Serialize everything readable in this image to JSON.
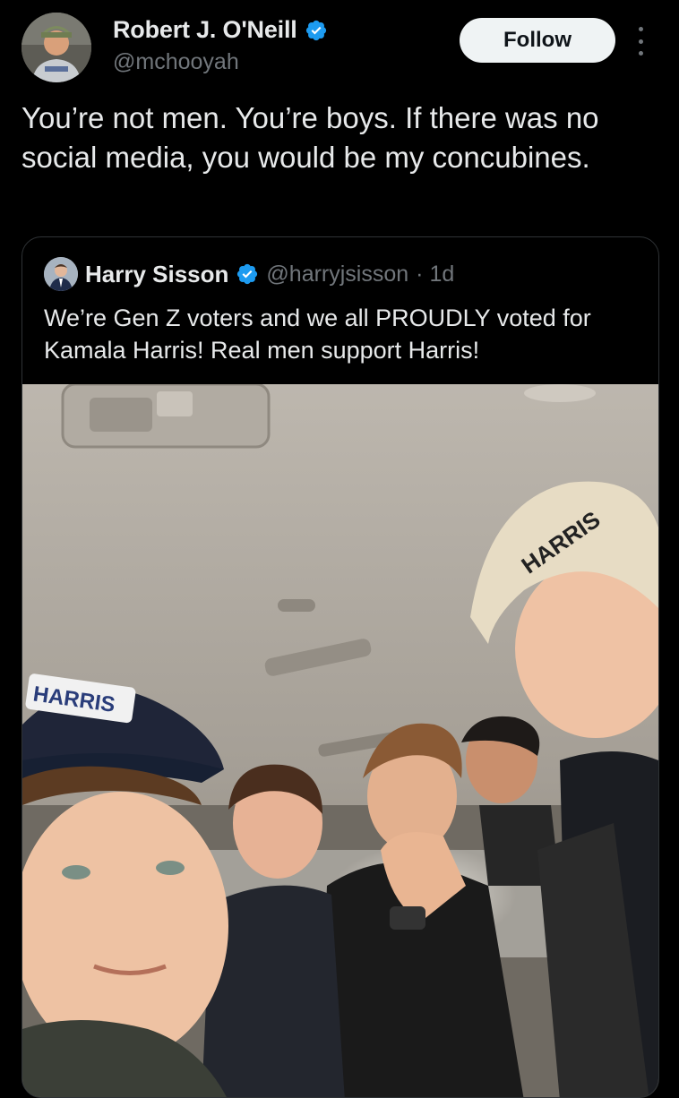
{
  "tweet": {
    "author_name": "Robert J. O'Neill",
    "author_handle": "@mchooyah",
    "follow_label": "Follow",
    "text": "You’re not men. You’re boys. If there was no social media, you would be my concubines."
  },
  "quoted_tweet": {
    "author_name": "Harry Sisson",
    "author_handle": "@harryjsisson",
    "time": "· 1d",
    "text": "We’re Gen Z voters and we all PROUDLY voted for Kamala Harris! Real men support Harris!"
  },
  "icons": {
    "verified": "verified-badge-icon",
    "more": "more-options-icon"
  },
  "colors": {
    "background": "#000000",
    "text": "#e7e9ea",
    "muted": "#71767b",
    "verified_blue": "#1d9bf0",
    "follow_bg": "#eff3f4",
    "border": "#2f3336"
  }
}
